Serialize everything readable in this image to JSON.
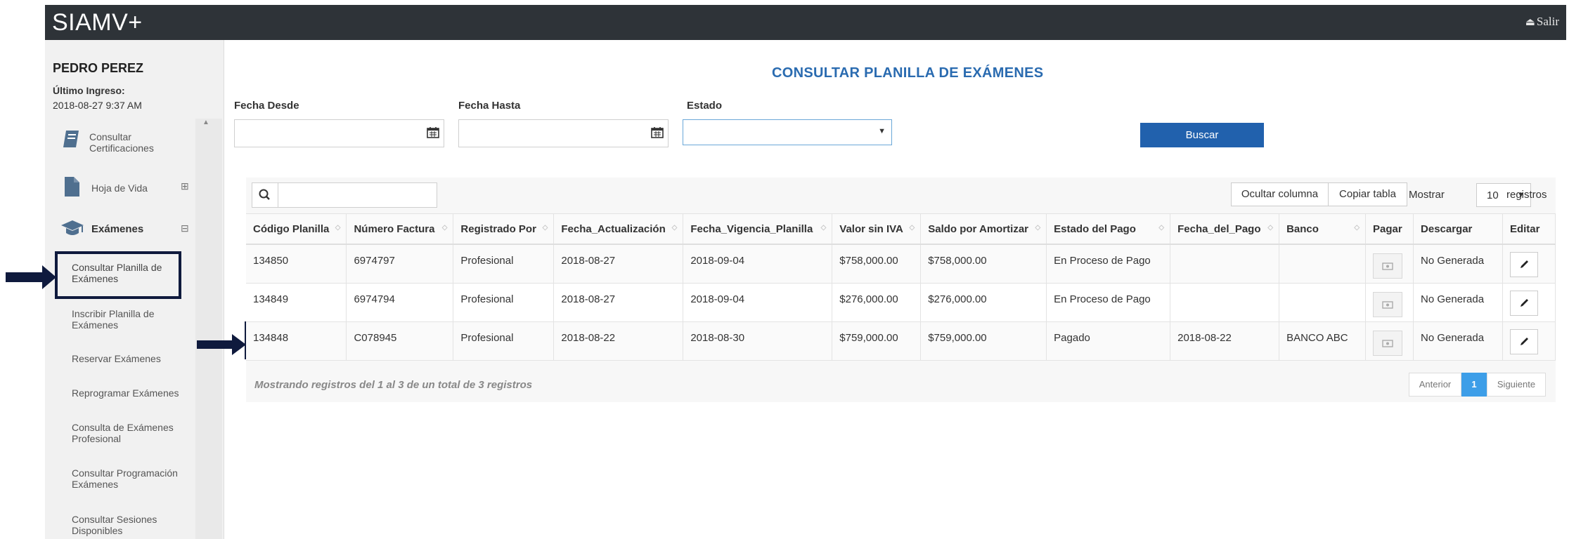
{
  "header": {
    "brand": "SIAMV+",
    "logout_label": "Salir",
    "bg_color": "#2e3338"
  },
  "user": {
    "name": "PEDRO PEREZ",
    "last_login_label": "Último Ingreso:",
    "last_login_value": "2018-08-27 9:37 AM"
  },
  "sidebar": {
    "items": [
      {
        "label_line1": "Consultar",
        "label_line2": "Certificaciones",
        "icon": "book-icon"
      },
      {
        "label": "Hoja de Vida",
        "icon": "document-icon",
        "toggle": "⊞"
      },
      {
        "label": "Exámenes",
        "icon": "graduation-cap-icon",
        "toggle": "⊟"
      }
    ],
    "sub_items": [
      {
        "line1": "Consultar Planilla de",
        "line2": "Exámenes"
      },
      {
        "line1": "Inscribir Planilla de",
        "line2": "Exámenes"
      },
      {
        "line1": "Reservar Exámenes",
        "line2": ""
      },
      {
        "line1": "Reprogramar Exámenes",
        "line2": ""
      },
      {
        "line1": "Consulta de Exámenes",
        "line2": "Profesional"
      },
      {
        "line1": "Consultar Programación",
        "line2": "Exámenes"
      },
      {
        "line1": "Consultar Sesiones",
        "line2": "Disponibles"
      }
    ]
  },
  "page": {
    "title": "CONSULTAR PLANILLA DE EXÁMENES"
  },
  "filters": {
    "fecha_desde_label": "Fecha Desde",
    "fecha_desde_value": "",
    "fecha_hasta_label": "Fecha Hasta",
    "fecha_hasta_value": "",
    "estado_label": "Estado",
    "estado_value": "",
    "search_button": "Buscar"
  },
  "table_tools": {
    "search_value": "",
    "hide_column": "Ocultar columna",
    "copy_table": "Copiar tabla",
    "show_label": "Mostrar",
    "page_size": "10",
    "records_label": "registros"
  },
  "table": {
    "columns": [
      "Código Planilla",
      "Número Factura",
      "Registrado Por",
      "Fecha_Actualización",
      "Fecha_Vigencia_Planilla",
      "Valor sin IVA",
      "Saldo por Amortizar",
      "Estado del Pago",
      "Fecha_del_Pago",
      "Banco",
      "Pagar",
      "Descargar",
      "Editar"
    ],
    "rows": [
      [
        "134850",
        "6974797",
        "Profesional",
        "2018-08-27",
        "2018-09-04",
        "$758,000.00",
        "$758,000.00",
        "En Proceso de Pago",
        "",
        "",
        "",
        "No Generada",
        ""
      ],
      [
        "134849",
        "6974794",
        "Profesional",
        "2018-08-27",
        "2018-09-04",
        "$276,000.00",
        "$276,000.00",
        "En Proceso de Pago",
        "",
        "",
        "",
        "No Generada",
        ""
      ],
      [
        "134848",
        "C078945",
        "Profesional",
        "2018-08-22",
        "2018-08-30",
        "$759,000.00",
        "$759,000.00",
        "Pagado",
        "2018-08-22",
        "BANCO ABC",
        "",
        "No Generada",
        ""
      ]
    ]
  },
  "footer": {
    "info": "Mostrando registros del 1 al 3 de un total de 3 registros",
    "prev": "Anterior",
    "page": "1",
    "next": "Siguiente"
  },
  "colors": {
    "accent": "#2161ad",
    "title": "#2a6bb0",
    "highlight": "#0f1a3d",
    "page_active": "#3d9ee8"
  }
}
